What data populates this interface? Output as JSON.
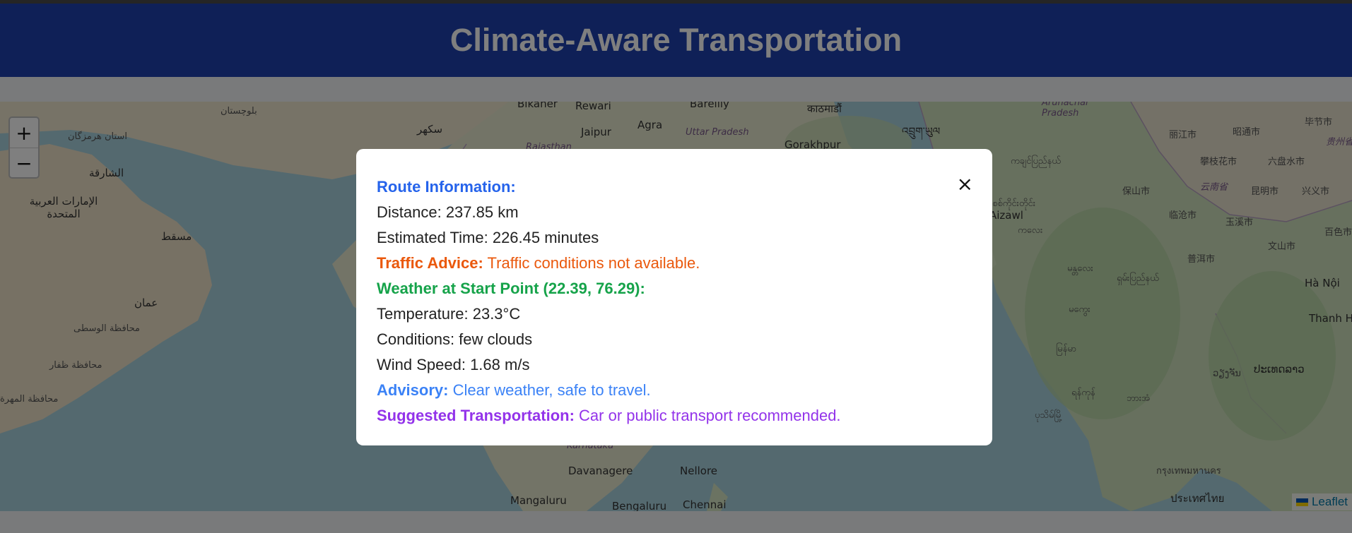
{
  "header": {
    "title": "Climate-Aware Transportation"
  },
  "map": {
    "zoom_in": "+",
    "zoom_out": "−",
    "attribution": "Leaflet",
    "labels": {
      "bikaner": "Bikaner",
      "rewari": "Rewari",
      "bareilly": "Bareilly",
      "jaipur": "Jaipur",
      "agra": "Agra",
      "uttar_pradesh": "Uttar Pradesh",
      "gorakhpur": "Gorakhpur",
      "rajasthan": "Rajasthan",
      "kathmandu": "काठमाडौं",
      "arunachal": "Arunachal Pradesh",
      "bhutan": "འབྲུག་ཡུལ",
      "sukkur": "سکھر",
      "balochistan": "بلوچستان",
      "hormozgan": "استان هرمزگان",
      "sharjah": "الشارقة",
      "uae": "الإمارات العربية المتحدة",
      "muscat": "مسقط",
      "oman": "عمان",
      "wusta": "محافظة الوسطى",
      "dhofar": "محافظة ظفار",
      "mahra": "محافظة المهرة",
      "karnataka": "Karnataka",
      "davanagere": "Davanagere",
      "nellore": "Nellore",
      "mangaluru": "Mangaluru",
      "bengaluru": "Bengaluru",
      "chennai": "Chennai",
      "aizawl": "Aizawl",
      "myanmar1": "ကချင်ပြည်နယ်",
      "myanmar2": "စစ်ကိုင်းတိုင်း",
      "myanmar3": "ကလေး",
      "myanmar4": "မန္တလေး",
      "myanmar5": "ရှမ်းပြည်နယ်",
      "myanmar6": "မကွေး",
      "myanmar7": "မြန်မာ",
      "yangon": "ရန်ကုန်",
      "pathein": "ပုသိမ်မြို့",
      "hpaan": "ဘားအံ",
      "vientiane": "ວຽງຈັນ",
      "laos": "ປະເທດລາວ",
      "bangkok": "กรุงเทพมหานคร",
      "thailand": "ประเทศไทย",
      "hanoi": "Hà Nội",
      "thanhhoa": "Thanh Hóa",
      "lijiang": "丽江市",
      "zhaotong": "昭通市",
      "bijie": "毕节市",
      "guizhou": "贵州省",
      "panzhihua": "攀枝花市",
      "liupanshui": "六盘水市",
      "baoshan": "保山市",
      "yunnan": "云南省",
      "kunming": "昆明市",
      "xingyi": "兴义市",
      "lincang": "临沧市",
      "yuxi": "玉溪市",
      "baise": "百色市",
      "wenshan": "文山市",
      "puer": "普洱市"
    }
  },
  "modal": {
    "close_label": "×",
    "route_heading": "Route Information:",
    "distance": "Distance: 237.85 km",
    "est_time": "Estimated Time: 226.45 minutes",
    "traffic_label": "Traffic Advice:",
    "traffic_value": "Traffic conditions not available.",
    "weather_heading": "Weather at Start Point (22.39, 76.29):",
    "temperature": "Temperature: 23.3°C",
    "conditions": "Conditions: few clouds",
    "wind": "Wind Speed: 1.68 m/s",
    "advisory_label": "Advisory:",
    "advisory_value": "Clear weather, safe to travel.",
    "suggest_label": "Suggested Transportation:",
    "suggest_value": "Car or public transport recommended."
  },
  "colors": {
    "header_bg": "#1e40af",
    "route_heading": "#2563eb",
    "traffic": "#ea580c",
    "weather": "#16a34a",
    "advisory": "#3b82f6",
    "suggest": "#9333ea"
  }
}
